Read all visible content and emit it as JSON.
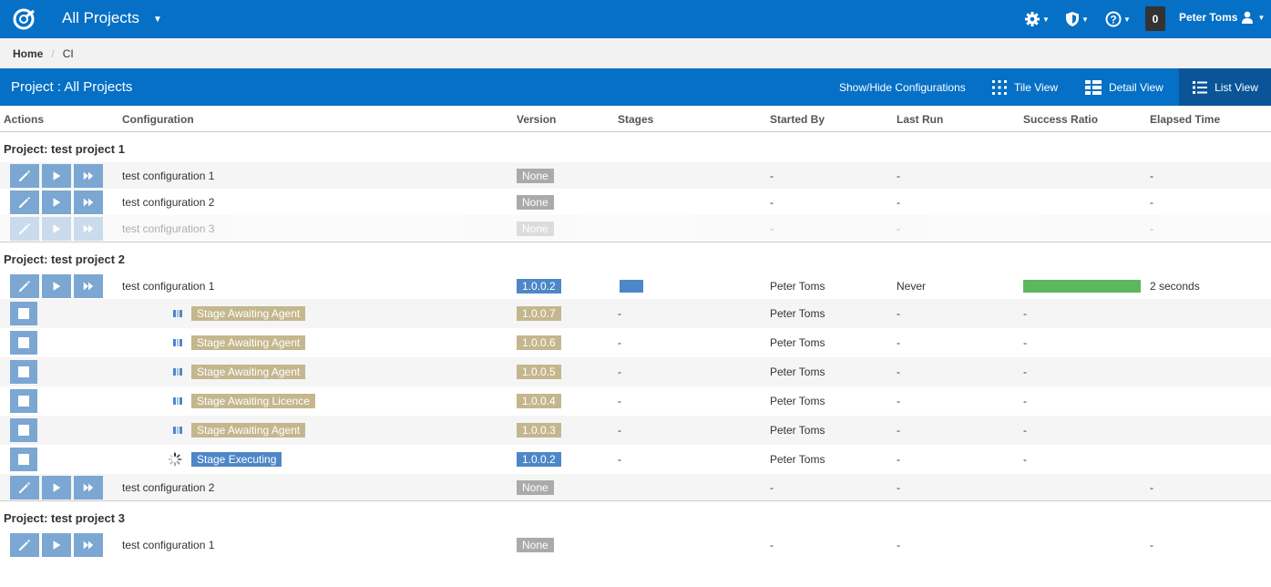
{
  "topnav": {
    "title": "All Projects",
    "notification_count": "0",
    "user_name": "Peter Toms",
    "icons": [
      "logo-icon",
      "gear-icon",
      "shield-icon",
      "help-icon",
      "user-icon"
    ]
  },
  "breadcrumb": {
    "home": "Home",
    "current": "CI"
  },
  "project_bar": {
    "title": "Project : All Projects",
    "show_hide": "Show/Hide Configurations",
    "tile_view": "Tile View",
    "detail_view": "Detail View",
    "list_view": "List View"
  },
  "columns": {
    "actions": "Actions",
    "configuration": "Configuration",
    "version": "Version",
    "stages": "Stages",
    "started_by": "Started By",
    "last_run": "Last Run",
    "success_ratio": "Success Ratio",
    "elapsed_time": "Elapsed Time"
  },
  "colors": {
    "brand": "#0570c5",
    "button": "#7ba7d2",
    "success": "#5cb85c",
    "stage_tan": "#c4b78e",
    "stage_blue": "#4e87c8"
  },
  "groups": [
    {
      "title": "Project: test project 1",
      "rows": [
        {
          "name": "test configuration 1",
          "version": "None",
          "started_by": "-",
          "last_run": "-",
          "elapsed": "-"
        },
        {
          "name": "test configuration 2",
          "version": "None",
          "started_by": "-",
          "last_run": "-",
          "elapsed": "-"
        },
        {
          "name": "test configuration 3",
          "version": "None",
          "started_by": "-",
          "last_run": "-",
          "elapsed": "-"
        }
      ]
    },
    {
      "title": "Project: test project 2",
      "rows": [
        {
          "name": "test configuration 1",
          "version": "1.0.0.2",
          "started_by": "Peter Toms",
          "last_run": "Never",
          "success_ratio": 1.0,
          "elapsed": "2 seconds"
        },
        {
          "name": "test configuration 2",
          "version": "None",
          "started_by": "-",
          "last_run": "-",
          "elapsed": "-"
        }
      ],
      "stages": [
        {
          "status": "Stage Awaiting Agent",
          "version": "1.0.0.7",
          "stages": "-",
          "started_by": "Peter Toms",
          "last_run": "-",
          "success_ratio": "-"
        },
        {
          "status": "Stage Awaiting Agent",
          "version": "1.0.0.6",
          "stages": "-",
          "started_by": "Peter Toms",
          "last_run": "-",
          "success_ratio": "-"
        },
        {
          "status": "Stage Awaiting Agent",
          "version": "1.0.0.5",
          "stages": "-",
          "started_by": "Peter Toms",
          "last_run": "-",
          "success_ratio": "-"
        },
        {
          "status": "Stage Awaiting Licence",
          "version": "1.0.0.4",
          "stages": "-",
          "started_by": "Peter Toms",
          "last_run": "-",
          "success_ratio": "-"
        },
        {
          "status": "Stage Awaiting Agent",
          "version": "1.0.0.3",
          "stages": "-",
          "started_by": "Peter Toms",
          "last_run": "-",
          "success_ratio": "-"
        },
        {
          "status": "Stage Executing",
          "version": "1.0.0.2",
          "stages": "-",
          "started_by": "Peter Toms",
          "last_run": "-",
          "success_ratio": "-"
        }
      ]
    },
    {
      "title": "Project: test project 3",
      "rows": [
        {
          "name": "test configuration 1",
          "version": "None",
          "started_by": "-",
          "last_run": "-",
          "elapsed": "-"
        }
      ]
    }
  ]
}
